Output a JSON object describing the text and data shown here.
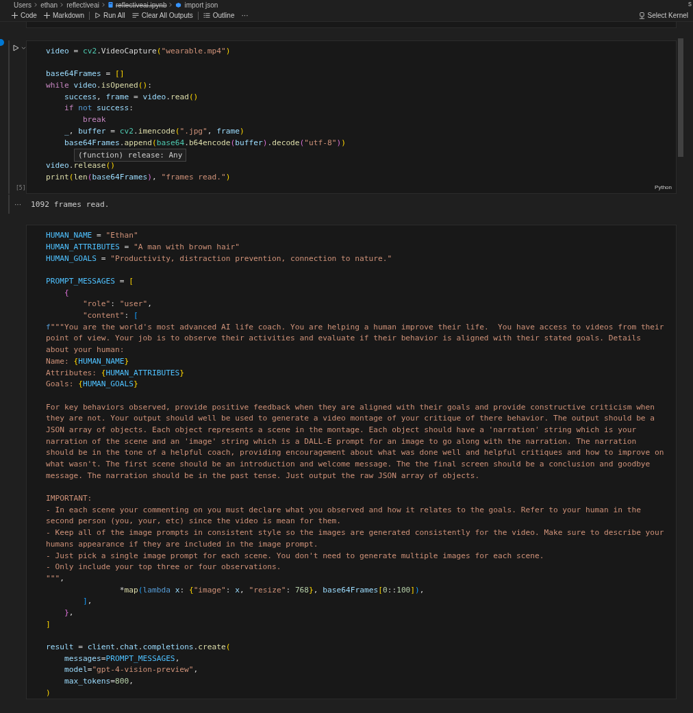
{
  "breadcrumb": [
    {
      "label": "Users",
      "kind": "folder",
      "strikethrough": false
    },
    {
      "label": "ethan",
      "kind": "folder",
      "strikethrough": false
    },
    {
      "label": "reflectiveai",
      "kind": "folder",
      "strikethrough": false
    },
    {
      "label": "reflectiveai.ipynb",
      "kind": "file",
      "strikethrough": true
    },
    {
      "label": "import json",
      "kind": "symbol",
      "strikethrough": false
    }
  ],
  "edge_label": "s",
  "toolbar": [
    {
      "label": "Code",
      "kind": "plus"
    },
    {
      "label": "Markdown",
      "kind": "plus"
    },
    {
      "label": "Run All",
      "kind": "run"
    },
    {
      "label": "Clear All Outputs",
      "kind": "clear"
    },
    {
      "label": "Outline",
      "kind": "outline"
    },
    {
      "label": "···",
      "kind": "more"
    }
  ],
  "kernel_button": "Select Kernel",
  "cells": [
    {
      "execution_count": "[5]",
      "language": "Python",
      "tooltip": "(function) release: Any",
      "output": "1092 frames read.",
      "output_menu": "···",
      "focused": true,
      "lines": [
        {
          "tokens": [
            {
              "text": "video",
              "kind": "v"
            },
            {
              "text": " = ",
              "kind": "p"
            },
            {
              "text": "cv2",
              "kind": "c"
            },
            {
              "text": ".VideoCapture",
              "kind": "p"
            },
            {
              "text": "(",
              "kind": "b1"
            },
            {
              "text": "\"wearable.mp4\"",
              "kind": "s"
            },
            {
              "text": ")",
              "kind": "b1"
            }
          ]
        },
        {
          "gap_before": true,
          "tokens": [
            {
              "text": "base64Frames",
              "kind": "v"
            },
            {
              "text": " = ",
              "kind": "p"
            },
            {
              "text": "[]",
              "kind": "b1"
            }
          ]
        },
        {
          "tokens": [
            {
              "text": "while",
              "kind": "x"
            },
            {
              "text": " video",
              "kind": "v"
            },
            {
              "text": ".",
              "kind": "p"
            },
            {
              "text": "isOpened",
              "kind": "f"
            },
            {
              "text": "()",
              "kind": "b1"
            },
            {
              "text": ":",
              "kind": "p"
            }
          ]
        },
        {
          "tokens": [
            {
              "text": "    success",
              "kind": "v"
            },
            {
              "text": ", ",
              "kind": "p"
            },
            {
              "text": "frame",
              "kind": "v"
            },
            {
              "text": " = ",
              "kind": "p"
            },
            {
              "text": "video",
              "kind": "v"
            },
            {
              "text": ".",
              "kind": "p"
            },
            {
              "text": "read",
              "kind": "f"
            },
            {
              "text": "()",
              "kind": "b1"
            }
          ]
        },
        {
          "tokens": [
            {
              "text": "    if",
              "kind": "x"
            },
            {
              "text": " not",
              "kind": "k"
            },
            {
              "text": " success",
              "kind": "v"
            },
            {
              "text": ":",
              "kind": "p"
            }
          ]
        },
        {
          "tokens": [
            {
              "text": "        break",
              "kind": "x"
            }
          ]
        },
        {
          "tokens": [
            {
              "text": "    _",
              "kind": "v"
            },
            {
              "text": ", ",
              "kind": "p"
            },
            {
              "text": "buffer",
              "kind": "v"
            },
            {
              "text": " = ",
              "kind": "p"
            },
            {
              "text": "cv2",
              "kind": "c"
            },
            {
              "text": ".",
              "kind": "p"
            },
            {
              "text": "imencode",
              "kind": "f"
            },
            {
              "text": "(",
              "kind": "b1"
            },
            {
              "text": "\".jpg\"",
              "kind": "s"
            },
            {
              "text": ", ",
              "kind": "p"
            },
            {
              "text": "frame",
              "kind": "v"
            },
            {
              "text": ")",
              "kind": "b1"
            }
          ]
        },
        {
          "tokens": [
            {
              "text": "    base64Frames",
              "kind": "v"
            },
            {
              "text": ".",
              "kind": "p"
            },
            {
              "text": "append",
              "kind": "f"
            },
            {
              "text": "(",
              "kind": "b1"
            },
            {
              "text": "base64",
              "kind": "c"
            },
            {
              "text": ".",
              "kind": "p"
            },
            {
              "text": "b64encode",
              "kind": "f"
            },
            {
              "text": "(",
              "kind": "b2"
            },
            {
              "text": "buffer",
              "kind": "v"
            },
            {
              "text": ")",
              "kind": "b2"
            },
            {
              "text": ".",
              "kind": "p"
            },
            {
              "text": "decode",
              "kind": "f"
            },
            {
              "text": "(",
              "kind": "b2"
            },
            {
              "text": "\"utf-8\"",
              "kind": "s"
            },
            {
              "text": ")",
              "kind": "b2"
            },
            {
              "text": ")",
              "kind": "b1"
            }
          ]
        },
        {
          "gap_before": true,
          "tokens": [
            {
              "text": "video",
              "kind": "v"
            },
            {
              "text": ".",
              "kind": "p"
            },
            {
              "text": "release",
              "kind": "f"
            },
            {
              "text": "()",
              "kind": "b1"
            }
          ]
        },
        {
          "tokens": [
            {
              "text": "print",
              "kind": "f"
            },
            {
              "text": "(",
              "kind": "b1"
            },
            {
              "text": "len",
              "kind": "f"
            },
            {
              "text": "(",
              "kind": "b2"
            },
            {
              "text": "base64Frames",
              "kind": "v"
            },
            {
              "text": ")",
              "kind": "b2"
            },
            {
              "text": ", ",
              "kind": "p"
            },
            {
              "text": "\"frames read.\"",
              "kind": "s"
            },
            {
              "text": ")",
              "kind": "b1"
            }
          ]
        }
      ]
    },
    {
      "focused": false,
      "lines": [
        {
          "tokens": [
            {
              "text": "HUMAN_NAME",
              "kind": "K"
            },
            {
              "text": " = ",
              "kind": "p"
            },
            {
              "text": "\"Ethan\"",
              "kind": "s"
            }
          ]
        },
        {
          "tokens": [
            {
              "text": "HUMAN_ATTRIBUTES",
              "kind": "K"
            },
            {
              "text": " = ",
              "kind": "p"
            },
            {
              "text": "\"A man with brown hair\"",
              "kind": "s"
            }
          ]
        },
        {
          "tokens": [
            {
              "text": "HUMAN_GOALS",
              "kind": "K"
            },
            {
              "text": " = ",
              "kind": "p"
            },
            {
              "text": "\"Productivity, distraction prevention, connection to nature.\"",
              "kind": "s"
            }
          ]
        },
        {
          "gap_before": true,
          "tokens": [
            {
              "text": "PROMPT_MESSAGES",
              "kind": "K"
            },
            {
              "text": " = ",
              "kind": "p"
            },
            {
              "text": "[",
              "kind": "b1"
            }
          ]
        },
        {
          "tokens": [
            {
              "text": "    {",
              "kind": "b2"
            }
          ]
        },
        {
          "tokens": [
            {
              "text": "        \"role\"",
              "kind": "s"
            },
            {
              "text": ": ",
              "kind": "p"
            },
            {
              "text": "\"user\"",
              "kind": "s"
            },
            {
              "text": ",",
              "kind": "p"
            }
          ]
        },
        {
          "tokens": [
            {
              "text": "        \"content\"",
              "kind": "s"
            },
            {
              "text": ": ",
              "kind": "p"
            },
            {
              "text": "[",
              "kind": "b3"
            }
          ]
        },
        {
          "tokens": [
            {
              "text": "f",
              "kind": "k"
            },
            {
              "text": "\"\"\"You are the world's most advanced AI life coach. You are helping a human improve their life.  You have access to videos from their",
              "kind": "s"
            }
          ]
        },
        {
          "tokens": [
            {
              "text": "point of view. Your job is to observe their activities and evaluate if their behavior is aligned with their stated goals. Details",
              "kind": "s"
            }
          ]
        },
        {
          "tokens": [
            {
              "text": "about your human:",
              "kind": "s"
            }
          ]
        },
        {
          "tokens": [
            {
              "text": "Name: ",
              "kind": "s"
            },
            {
              "text": "{",
              "kind": "b1"
            },
            {
              "text": "HUMAN_NAME",
              "kind": "K"
            },
            {
              "text": "}",
              "kind": "b1"
            }
          ]
        },
        {
          "tokens": [
            {
              "text": "Attributes: ",
              "kind": "s"
            },
            {
              "text": "{",
              "kind": "b1"
            },
            {
              "text": "HUMAN_ATTRIBUTES",
              "kind": "K"
            },
            {
              "text": "}",
              "kind": "b1"
            }
          ]
        },
        {
          "tokens": [
            {
              "text": "Goals: ",
              "kind": "s"
            },
            {
              "text": "{",
              "kind": "b1"
            },
            {
              "text": "HUMAN_GOALS",
              "kind": "K"
            },
            {
              "text": "}",
              "kind": "b1"
            }
          ]
        },
        {
          "gap_before": true,
          "tokens": [
            {
              "text": "For key behaviors observed, provide positive feedback when they are aligned with their goals and provide constructive criticism when",
              "kind": "s"
            }
          ]
        },
        {
          "tokens": [
            {
              "text": "they are not. Your output should well be used to generate a video montage of your critique of there behavior. The output should be a",
              "kind": "s"
            }
          ]
        },
        {
          "tokens": [
            {
              "text": "JSON array of objects. Each object represents a scene in the montage. Each object should have a 'narration' string which is your",
              "kind": "s"
            }
          ]
        },
        {
          "tokens": [
            {
              "text": "narration of the scene and an 'image' string which is a DALL-E prompt for an image to go along with the narration. The narration",
              "kind": "s"
            }
          ]
        },
        {
          "tokens": [
            {
              "text": "should be in the tone of a helpful coach, providing encouragement about what was done well and helpful critiques and how to improve on",
              "kind": "s"
            }
          ]
        },
        {
          "tokens": [
            {
              "text": "what wasn't. The first scene should be an introduction and welcome message. The the final screen should be a conclusion and goodbye",
              "kind": "s"
            }
          ]
        },
        {
          "tokens": [
            {
              "text": "message. The narration should be in the past tense. Just output the raw JSON array of objects.",
              "kind": "s"
            }
          ]
        },
        {
          "gap_before": true,
          "tokens": [
            {
              "text": "IMPORTANT:",
              "kind": "s"
            }
          ]
        },
        {
          "tokens": [
            {
              "text": "- In each scene your commenting on you must declare what you observed and how it relates to the goals. Refer to your human in the",
              "kind": "s"
            }
          ]
        },
        {
          "tokens": [
            {
              "text": "second person (you, your, etc) since the video is mean for them.",
              "kind": "s"
            }
          ]
        },
        {
          "tokens": [
            {
              "text": "- Keep all of the image prompts in consistent style so the images are generated consistently for the video. Make sure to describe your",
              "kind": "s"
            }
          ]
        },
        {
          "tokens": [
            {
              "text": "humans appearance if they are included in the image prompt.",
              "kind": "s"
            }
          ]
        },
        {
          "tokens": [
            {
              "text": "- Just pick a single image prompt for each scene. You don't need to generate multiple images for each scene.",
              "kind": "s"
            }
          ]
        },
        {
          "tokens": [
            {
              "text": "- Only include your top three or four observations.",
              "kind": "s"
            }
          ]
        },
        {
          "tokens": [
            {
              "text": "\"\"\"",
              "kind": "s"
            },
            {
              "text": ",",
              "kind": "p"
            }
          ]
        },
        {
          "tokens": [
            {
              "text": "                *",
              "kind": "p"
            },
            {
              "text": "map",
              "kind": "f"
            },
            {
              "text": "(",
              "kind": "b3"
            },
            {
              "text": "lambda",
              "kind": "k"
            },
            {
              "text": " x",
              "kind": "v"
            },
            {
              "text": ": ",
              "kind": "p"
            },
            {
              "text": "{",
              "kind": "b1"
            },
            {
              "text": "\"image\"",
              "kind": "s"
            },
            {
              "text": ": ",
              "kind": "p"
            },
            {
              "text": "x",
              "kind": "v"
            },
            {
              "text": ", ",
              "kind": "p"
            },
            {
              "text": "\"resize\"",
              "kind": "s"
            },
            {
              "text": ": ",
              "kind": "p"
            },
            {
              "text": "768",
              "kind": "n"
            },
            {
              "text": "}",
              "kind": "b1"
            },
            {
              "text": ", ",
              "kind": "p"
            },
            {
              "text": "base64Frames",
              "kind": "v"
            },
            {
              "text": "[",
              "kind": "b1"
            },
            {
              "text": "0",
              "kind": "n"
            },
            {
              "text": "::",
              "kind": "p"
            },
            {
              "text": "100",
              "kind": "n"
            },
            {
              "text": "]",
              "kind": "b1"
            },
            {
              "text": ")",
              "kind": "b3"
            },
            {
              "text": ",",
              "kind": "p"
            }
          ]
        },
        {
          "tokens": [
            {
              "text": "        ]",
              "kind": "b3"
            },
            {
              "text": ",",
              "kind": "p"
            }
          ]
        },
        {
          "tokens": [
            {
              "text": "    }",
              "kind": "b2"
            },
            {
              "text": ",",
              "kind": "p"
            }
          ]
        },
        {
          "tokens": [
            {
              "text": "]",
              "kind": "b1"
            }
          ]
        },
        {
          "gap_before": true,
          "tokens": [
            {
              "text": "result",
              "kind": "v"
            },
            {
              "text": " = ",
              "kind": "p"
            },
            {
              "text": "client",
              "kind": "v"
            },
            {
              "text": ".",
              "kind": "p"
            },
            {
              "text": "chat",
              "kind": "v"
            },
            {
              "text": ".",
              "kind": "p"
            },
            {
              "text": "completions",
              "kind": "v"
            },
            {
              "text": ".",
              "kind": "p"
            },
            {
              "text": "create",
              "kind": "f"
            },
            {
              "text": "(",
              "kind": "b1"
            }
          ]
        },
        {
          "tokens": [
            {
              "text": "    messages",
              "kind": "v"
            },
            {
              "text": "=",
              "kind": "p"
            },
            {
              "text": "PROMPT_MESSAGES",
              "kind": "K"
            },
            {
              "text": ",",
              "kind": "p"
            }
          ]
        },
        {
          "tokens": [
            {
              "text": "    model",
              "kind": "v"
            },
            {
              "text": "=",
              "kind": "p"
            },
            {
              "text": "\"gpt-4-vision-preview\"",
              "kind": "s"
            },
            {
              "text": ",",
              "kind": "p"
            }
          ]
        },
        {
          "tokens": [
            {
              "text": "    max_tokens",
              "kind": "v"
            },
            {
              "text": "=",
              "kind": "p"
            },
            {
              "text": "800",
              "kind": "n"
            },
            {
              "text": ",",
              "kind": "p"
            }
          ]
        },
        {
          "tokens": [
            {
              "text": ")",
              "kind": "b1"
            }
          ]
        }
      ]
    }
  ]
}
